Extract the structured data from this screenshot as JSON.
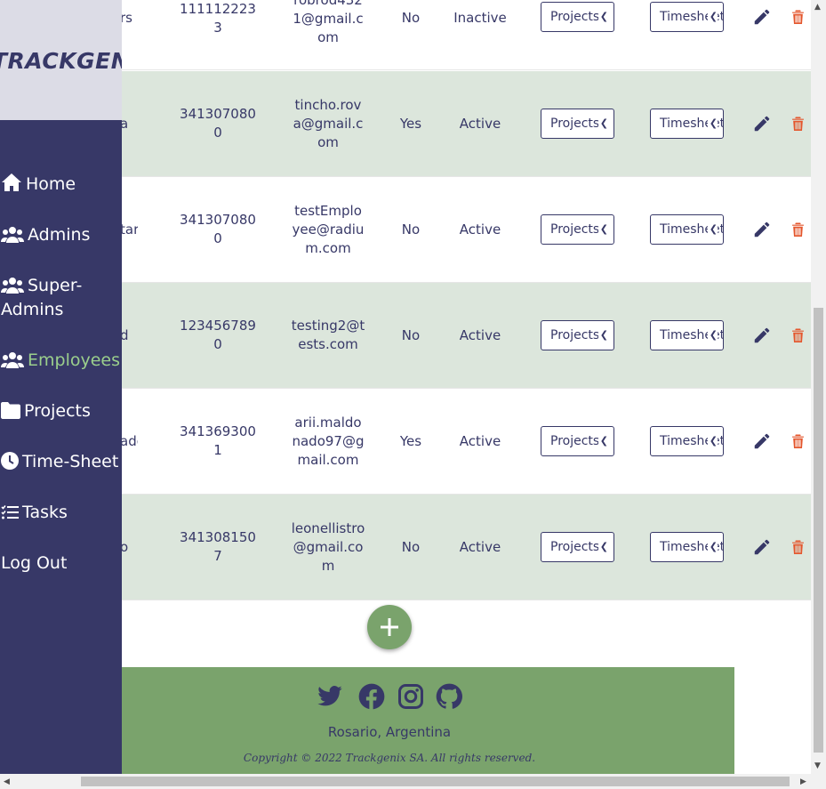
{
  "brand": {
    "logo_text": "TRACKGENIX"
  },
  "sidebar": {
    "items": [
      {
        "label": "Home",
        "icon": "home-icon",
        "active": false
      },
      {
        "label": "Admins",
        "icon": "users-icon",
        "active": false
      },
      {
        "label": "Super-",
        "label2": "Admins",
        "icon": "users-icon",
        "active": false
      },
      {
        "label": "Employees",
        "icon": "users-icon",
        "active": true
      },
      {
        "label": "Projects",
        "icon": "folder-icon",
        "active": false
      },
      {
        "label": "Time-Sheet",
        "icon": "clock-icon",
        "active": false
      },
      {
        "label": "Tasks",
        "icon": "tasks-icon",
        "active": false
      },
      {
        "label": "Log Out",
        "icon": "",
        "active": false
      }
    ]
  },
  "employees": {
    "rows": [
      {
        "name_tail": "rs",
        "phone": "1111122233",
        "email": "robrod4321@gmail.com",
        "is_admin": "No",
        "status": "Inactive",
        "projects_select": "Projects",
        "timesheets_select": "Timesheets"
      },
      {
        "name_tail": "a",
        "phone": "3413070800",
        "email": "tincho.rova@gmail.com",
        "is_admin": "Yes",
        "status": "Active",
        "projects_select": "Projects",
        "timesheets_select": "Timesheets"
      },
      {
        "name_tail": "tar",
        "phone": "3413070800",
        "email": "testEmployee@radium.com",
        "is_admin": "No",
        "status": "Active",
        "projects_select": "Projects",
        "timesheets_select": "Timesheets"
      },
      {
        "name_tail": "d",
        "phone": "1234567890",
        "email": "testing2@tests.com",
        "is_admin": "No",
        "status": "Active",
        "projects_select": "Projects",
        "timesheets_select": "Timesheets"
      },
      {
        "name_tail": "ado",
        "phone": "3413693001",
        "email": "arii.maldonado97@gmail.com",
        "is_admin": "Yes",
        "status": "Active",
        "projects_select": "Projects",
        "timesheets_select": "Timesheets"
      },
      {
        "name_tail": "o",
        "phone": "3413081507",
        "email": "leonellistro@gmail.com",
        "is_admin": "No",
        "status": "Active",
        "projects_select": "Projects",
        "timesheets_select": "Timesheets"
      }
    ]
  },
  "footer": {
    "location": "Rosario, Argentina",
    "copyright": "Copyright © 2022 Trackgenix SA. All rights reserved.",
    "social": [
      "twitter-icon",
      "facebook-icon",
      "instagram-icon",
      "github-icon"
    ]
  },
  "colors": {
    "sidebar_bg": "#373867",
    "accent_green": "#7aa36c",
    "active_nav": "#9bcf8c",
    "row_alt": "#dce6dc",
    "delete_red": "#e4572e"
  }
}
